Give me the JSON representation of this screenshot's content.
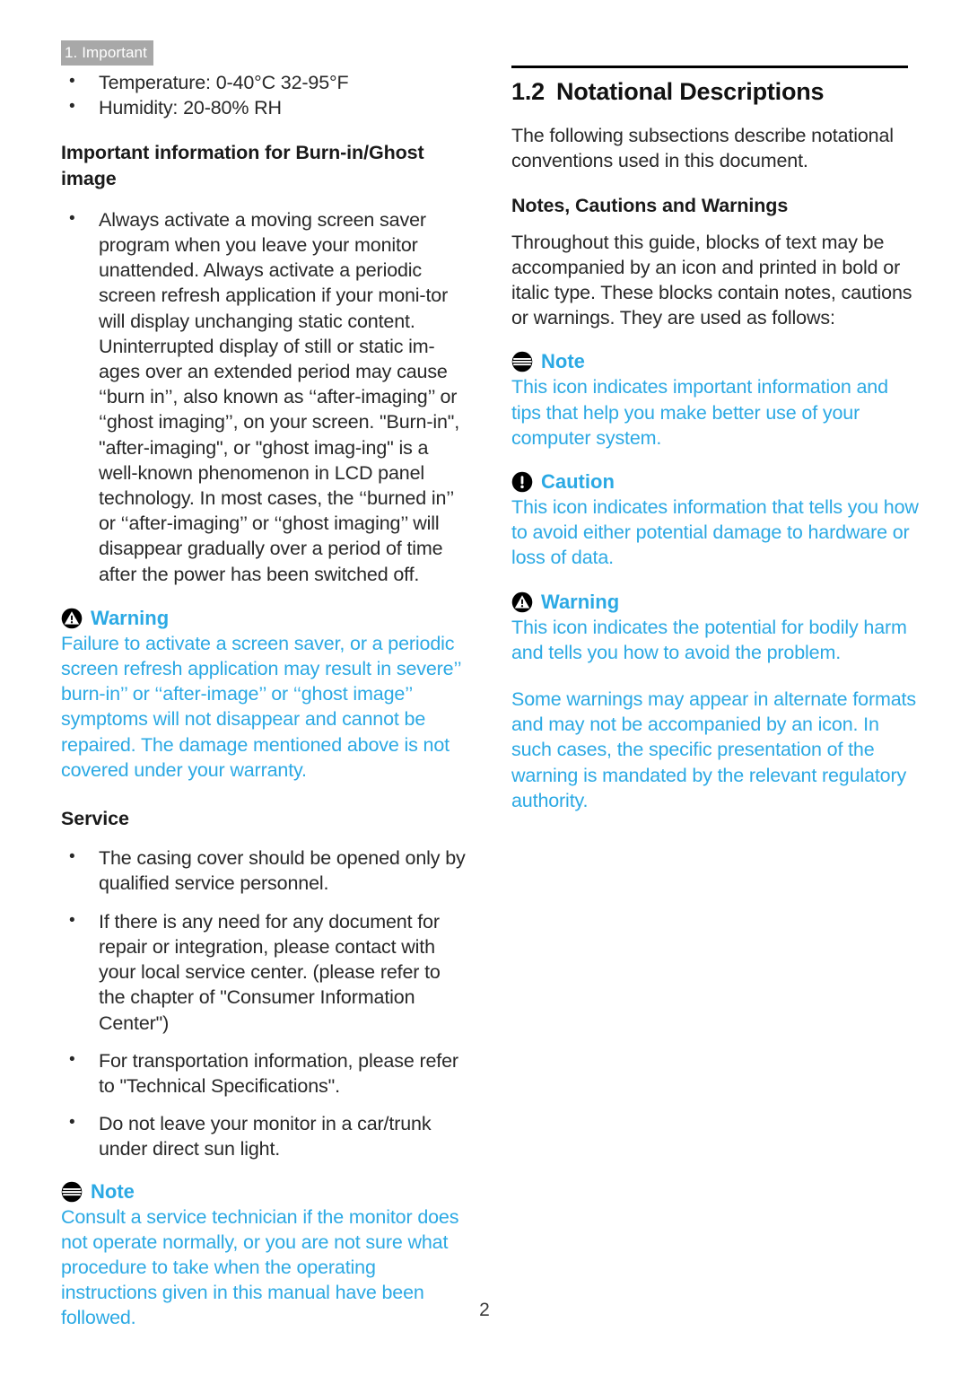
{
  "header": {
    "running_title": "1. Important"
  },
  "colors": {
    "accent_blue": "#2BA9E4",
    "header_gray": "#a8a8a8",
    "body_black": "#282828"
  },
  "left_column": {
    "env_bullets": [
      "Temperature: 0-40°C 32-95°F",
      "Humidity: 20-80% RH"
    ],
    "burnin_heading": "Important information for Burn-in/Ghost image",
    "burnin_bullets": [
      "Always activate a moving screen saver program when you leave your monitor unattended. Always activate a periodic screen refresh application if your moni-tor will display unchanging static content. Uninterrupted display of still or static im-ages over an extended period may cause ‘‘burn in’’, also known as ‘‘after-imaging’’ or ‘‘ghost imaging’’, on your screen. \"Burn-in\", \"after-imaging\", or \"ghost imag-ing\" is a well-known phenomenon in LCD panel technology. In most cases, the ‘‘burned in’’ or ‘‘after-imaging’’ or ‘‘ghost imaging’’ will disappear gradually over a period of time after the power has been switched off."
    ],
    "warning": {
      "icon": "warning-triangle-icon",
      "label": "Warning",
      "body": "Failure to activate a screen saver, or a periodic screen refresh application may result in severe’’ burn-in’’ or ‘‘after-image’’ or ‘‘ghost image’’ symptoms will not disappear and cannot be repaired. The damage mentioned above is not covered under your warranty."
    },
    "service_heading": "Service",
    "service_bullets": [
      "The casing cover should be opened only by qualified service personnel.",
      "If there is any need for any document for repair or integration, please contact with your local service center. (please refer to the chapter of \"Consumer Information Center\")",
      "For transportation information, please refer to \"Technical Specifications\".",
      "Do not leave your monitor in a car/trunk under direct sun light."
    ],
    "note": {
      "icon": "note-lines-icon",
      "label": "Note",
      "body": "Consult a service technician if the monitor does not operate normally, or you are not sure what procedure to take when the operating instructions given in this manual have been followed."
    }
  },
  "right_column": {
    "section_number": "1.2",
    "section_title": "Notational Descriptions",
    "intro": "The following subsections describe notational conventions used in this document.",
    "subheading": "Notes, Cautions and Warnings",
    "subintro": "Throughout this guide, blocks of text may be accompanied by an icon and printed in bold or italic type. These blocks contain notes, cautions or warnings. They are used as follows:",
    "note": {
      "icon": "note-lines-icon",
      "label": "Note",
      "body": "This icon indicates important information and tips that help you make better use of your computer system."
    },
    "caution": {
      "icon": "caution-exclamation-icon",
      "label": "Caution",
      "body": "This icon indicates information that tells you how to avoid either potential damage to hardware or loss of data."
    },
    "warning": {
      "icon": "warning-triangle-icon",
      "label": "Warning",
      "body": "This icon indicates the potential for bodily harm and tells you how to avoid the problem."
    },
    "closing": "Some warnings may appear in alternate formats and may not be accompanied by an icon. In such cases, the specific presentation of the warning is mandated by the relevant regulatory authority."
  },
  "footer": {
    "page_number": "2"
  }
}
